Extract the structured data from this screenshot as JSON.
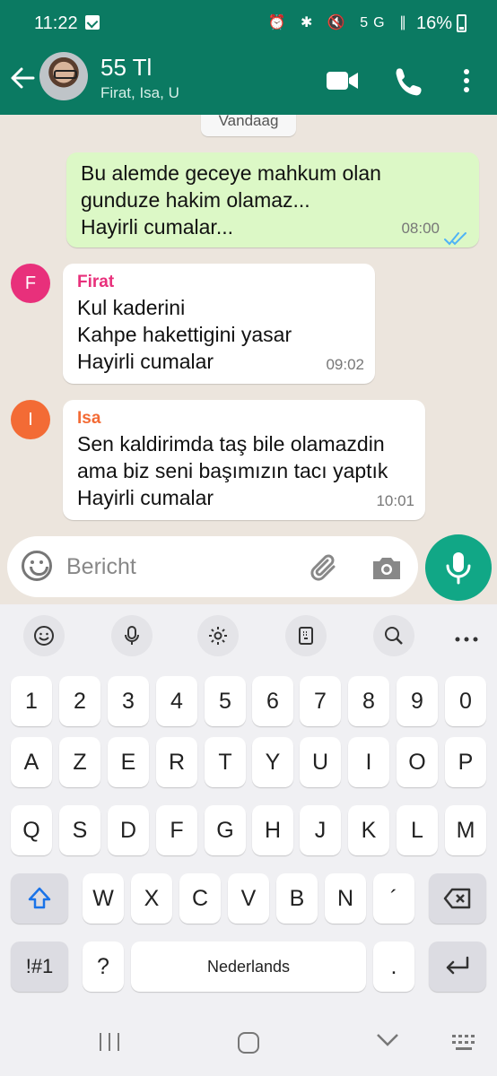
{
  "status_bar": {
    "time": "11:22",
    "battery": "16%",
    "icons": "⏰ ✱ 🔇 5G ∥"
  },
  "header": {
    "title": "55 Tl",
    "subtitle": "Firat, Isa, U"
  },
  "chat": {
    "date_label": "Vandaag",
    "messages": [
      {
        "type": "outgoing",
        "lines": [
          "Bu alemde geceye mahkum olan",
          "gunduze hakim olamaz...",
          "Hayirli cumalar..."
        ],
        "time": "08:00"
      },
      {
        "type": "incoming",
        "sender": "Firat",
        "initial": "F",
        "sender_color": "#e8307b",
        "lines": [
          "Kul kaderini",
          "Kahpe hakettigini yasar",
          "Hayirli cumalar"
        ],
        "time": "09:02"
      },
      {
        "type": "incoming",
        "sender": "Isa",
        "initial": "I",
        "sender_color": "#f36b35",
        "lines": [
          "Sen kaldirimda taş bile olamazdin",
          "ama biz seni başımızın tacı yaptık",
          "Hayirli cumalar"
        ],
        "time": "10:01"
      }
    ]
  },
  "composer": {
    "placeholder": "Bericht"
  },
  "keyboard": {
    "row_numbers": [
      "1",
      "2",
      "3",
      "4",
      "5",
      "6",
      "7",
      "8",
      "9",
      "0"
    ],
    "row1": [
      "A",
      "Z",
      "E",
      "R",
      "T",
      "Y",
      "U",
      "I",
      "O",
      "P"
    ],
    "row2": [
      "Q",
      "S",
      "D",
      "F",
      "G",
      "H",
      "J",
      "K",
      "L",
      "M"
    ],
    "row3": [
      "W",
      "X",
      "C",
      "V",
      "B",
      "N",
      "´"
    ],
    "sym_key": "!#1",
    "question_key": "?",
    "space_label": "Nederlands",
    "period_key": "."
  },
  "colors": {
    "header": "#0b7a62",
    "fab": "#11a786",
    "outgoing_bubble": "#dcf8c6",
    "read_ticks": "#4fb3f6"
  }
}
